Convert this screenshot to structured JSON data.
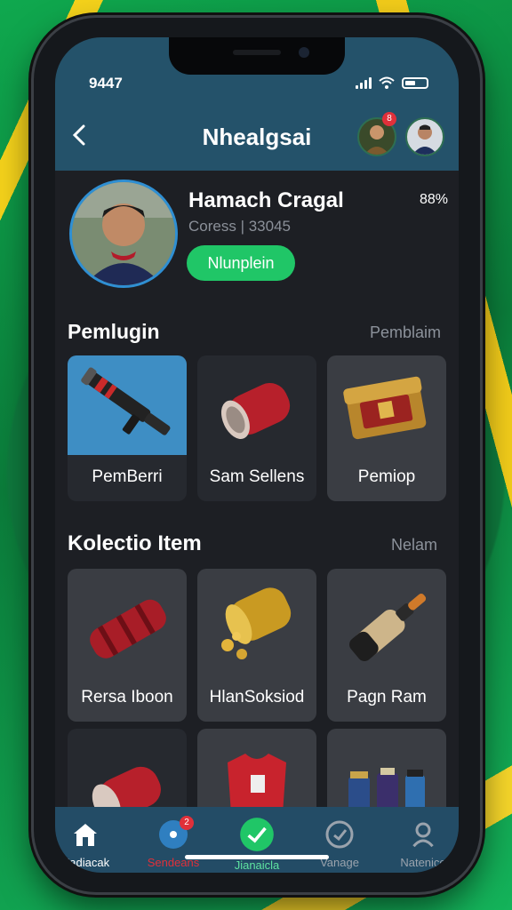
{
  "status": {
    "time": "9447"
  },
  "header": {
    "title": "Nhealgsai",
    "notification_count": "8"
  },
  "profile": {
    "name": "Hamach Cragal",
    "subtitle": "Coress | 33045",
    "button_label": "Nlunplein",
    "percent": "88%"
  },
  "section1": {
    "title": "Pemlugin",
    "link": "Pemblaim",
    "items": [
      {
        "label": "PemBerri"
      },
      {
        "label": "Sam Sellens"
      },
      {
        "label": "Pemiop"
      }
    ]
  },
  "section2": {
    "title": "Kolectio Item",
    "link": "Nelam",
    "items": [
      {
        "label": "Rersa Iboon"
      },
      {
        "label": "HlanSoksiod"
      },
      {
        "label": "Pagn Ram"
      }
    ]
  },
  "bottom_nav": [
    {
      "label": "Nadiacak",
      "icon": "home-icon"
    },
    {
      "label": "Sendeans",
      "icon": "compass-icon",
      "badge": "2"
    },
    {
      "label": "Jianaicla",
      "icon": "check-icon"
    },
    {
      "label": "Vanage",
      "icon": "gauge-icon"
    },
    {
      "label": "Natenice",
      "icon": "user-icon"
    }
  ],
  "colors": {
    "accent": "#20c667",
    "nav_active_red": "#e0303a",
    "topbar": "#24526a"
  }
}
